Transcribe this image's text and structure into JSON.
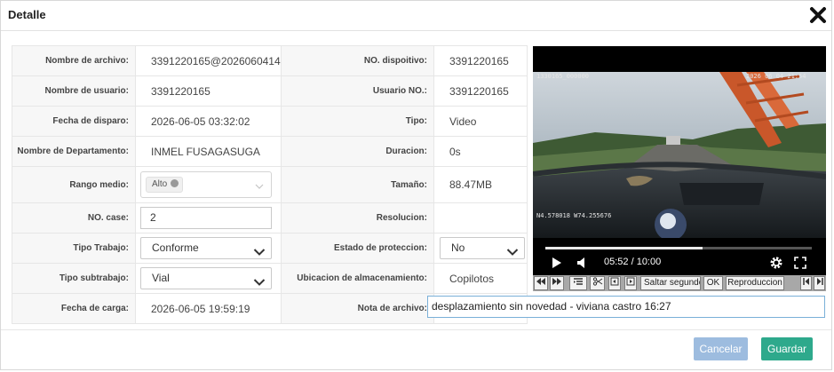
{
  "dialog": {
    "title": "Detalle"
  },
  "fields": {
    "nombre_archivo": {
      "label": "Nombre de archivo:",
      "value": "3391220165@2026060414:"
    },
    "no_dispositivo": {
      "label": "NO. dispoitivo:",
      "value": "3391220165"
    },
    "nombre_usuario": {
      "label": "Nombre de usuario:",
      "value": "3391220165"
    },
    "usuario_no": {
      "label": "Usuario NO.:",
      "value": "3391220165"
    },
    "fecha_disparo": {
      "label": "Fecha de disparo:",
      "value": "2026-06-05 03:32:02"
    },
    "tipo": {
      "label": "Tipo:",
      "value": "Video"
    },
    "departamento": {
      "label": "Nombre de Departamento:",
      "value": "INMEL FUSAGASUGA"
    },
    "duracion": {
      "label": "Duracion:",
      "value": "0s"
    },
    "rango_medio": {
      "label": "Rango medio:",
      "tag": "Alto"
    },
    "tamano": {
      "label": "Tamaño:",
      "value": "88.47MB"
    },
    "no_case": {
      "label": "NO. case:",
      "value": "2"
    },
    "resolucion": {
      "label": "Resolucion:",
      "value": ""
    },
    "tipo_trabajo": {
      "label": "Tipo Trabajo:",
      "selected": "Conforme"
    },
    "estado_proteccion": {
      "label": "Estado de proteccion:",
      "selected": "No"
    },
    "tipo_subtrabajo": {
      "label": "Tipo subtrabajo:",
      "selected": "Vial"
    },
    "ubicacion": {
      "label": "Ubicacion de almacenamiento:",
      "value": "Copilotos"
    },
    "fecha_carga": {
      "label": "Fecha de carga:",
      "value": "2026-06-05 19:59:19"
    },
    "nota_archivo": {
      "label": "Nota de archivo:",
      "value": "desplazamiento sin novedad - viviana castro 16:27"
    }
  },
  "video": {
    "osd_top_left": "1330165_000000",
    "osd_top_right": "2026 06 04 21:54",
    "osd_coords": "N4.578018  W74.255676",
    "current_time": "05:52",
    "total_time": "10:00",
    "time_display": "05:52 / 10:00",
    "progress": 0.59
  },
  "toolbar": {
    "skip_placeholder": "Saltar segundo",
    "ok_label": "OK",
    "playback_label": "Reproduccion"
  },
  "footer": {
    "cancel_label": "Cancelar",
    "save_label": "Guardar"
  },
  "colors": {
    "save": "#2ea98c",
    "cancel": "#9dbcdf",
    "note_border": "#7ab0d8"
  }
}
